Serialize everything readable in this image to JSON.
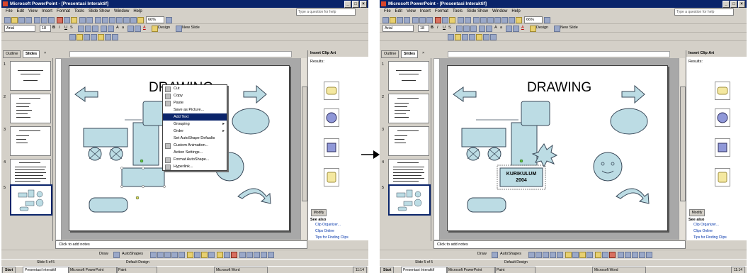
{
  "window": {
    "title": "Microsoft PowerPoint - [Presentasi Interaktif]",
    "buttons": [
      "_",
      "□",
      "×"
    ]
  },
  "menu": [
    "File",
    "Edit",
    "View",
    "Insert",
    "Format",
    "Tools",
    "Slide Show",
    "Window",
    "Help"
  ],
  "help_placeholder": "Type a question for help",
  "toolbar": {
    "font_name": "Arial",
    "font_size": "18",
    "zoom": "66%",
    "design_label": "Design",
    "new_slide_label": "New Slide"
  },
  "tabs": {
    "outline": "Outline",
    "slides": "Slides",
    "close": "×"
  },
  "slide_numbers": [
    "1",
    "2",
    "3",
    "4",
    "5"
  ],
  "slide": {
    "title": "DRAWING",
    "text_box": "KURIKULUM\n2004"
  },
  "notes_placeholder": "Click to add notes",
  "task_pane": {
    "title": "Insert Clip Art",
    "results_label": "Results:",
    "modify_button": "Modify",
    "see_also_label": "See also",
    "links": [
      "Clip Organizer...",
      "Clips Online",
      "Tips for Finding Clips"
    ]
  },
  "context_menu": {
    "items": [
      {
        "label": "Cut"
      },
      {
        "label": "Copy"
      },
      {
        "label": "Paste"
      },
      {
        "label": "Save as Picture..."
      },
      {
        "label": "Add Text",
        "highlighted": true
      },
      {
        "label": "Grouping",
        "submenu": true
      },
      {
        "label": "Order",
        "submenu": true
      },
      {
        "label": "Set AutoShape Defaults"
      },
      {
        "label": "Custom Animation..."
      },
      {
        "label": "Action Settings..."
      },
      {
        "label": "Format AutoShape..."
      },
      {
        "label": "Hyperlink..."
      }
    ]
  },
  "drawing_toolbar": {
    "draw_label": "Draw",
    "autoshapes_label": "AutoShapes"
  },
  "status": {
    "slide_of": "Slide 5 of 5",
    "design": "Default Design"
  },
  "taskbar": {
    "start": "Start",
    "items": [
      "Presentasi Interaktif",
      "Microsoft PowerPoint",
      "Paint",
      "Microsoft Word"
    ],
    "clock": "11:14"
  },
  "colors": {
    "title_bar": "#0a246a",
    "shape_fill": "#bcdce4",
    "shape_stroke": "#3a4a5a",
    "menu_highlight": "#0a246a"
  }
}
